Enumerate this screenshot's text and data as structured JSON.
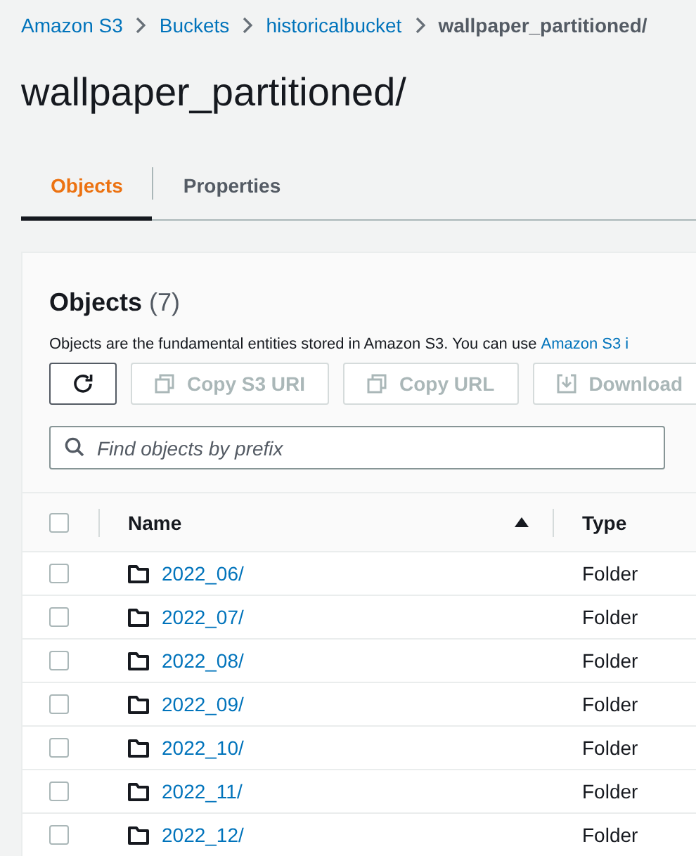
{
  "breadcrumbs": [
    {
      "label": "Amazon S3",
      "link": true
    },
    {
      "label": "Buckets",
      "link": true
    },
    {
      "label": "historicalbucket",
      "link": true
    },
    {
      "label": "wallpaper_partitioned/",
      "link": false
    }
  ],
  "title": "wallpaper_partitioned/",
  "tabs": [
    {
      "label": "Objects",
      "selected": true
    },
    {
      "label": "Properties",
      "selected": false
    }
  ],
  "objects_panel": {
    "heading": "Objects",
    "count": "(7)",
    "description": "Objects are the fundamental entities stored in Amazon S3. You can use",
    "description_link": "Amazon S3 i",
    "toolbar": [
      {
        "kind": "refresh",
        "disabled": false
      },
      {
        "kind": "copy",
        "label": "Copy S3 URI",
        "disabled": true
      },
      {
        "kind": "copy",
        "label": "Copy URL",
        "disabled": true
      },
      {
        "kind": "download",
        "label": "Download",
        "disabled": true
      }
    ],
    "search": {
      "placeholder": "Find objects by prefix"
    },
    "select_all": {
      "checked": false
    },
    "columns": [
      {
        "label": "Name",
        "sorted": true
      },
      {
        "label": "Type",
        "sorted": false
      }
    ],
    "rows": [
      {
        "name": "2022_06/",
        "type": "Folder",
        "checked": false
      },
      {
        "name": "2022_07/",
        "type": "Folder",
        "checked": false
      },
      {
        "name": "2022_08/",
        "type": "Folder",
        "checked": false
      },
      {
        "name": "2022_09/",
        "type": "Folder",
        "checked": false
      },
      {
        "name": "2022_10/",
        "type": "Folder",
        "checked": false
      },
      {
        "name": "2022_11/",
        "type": "Folder",
        "checked": false
      },
      {
        "name": "2022_12/",
        "type": "Folder",
        "checked": false
      }
    ]
  }
}
